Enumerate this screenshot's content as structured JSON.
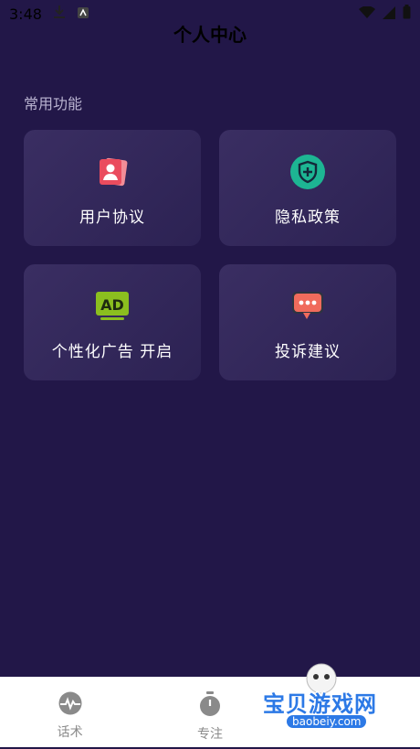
{
  "status_bar": {
    "time": "3:48"
  },
  "header": {
    "title": "个人中心"
  },
  "section": {
    "title": "常用功能"
  },
  "cards": [
    {
      "label": "用户协议",
      "icon": "user-agreement-icon",
      "color": "#ea4c5e"
    },
    {
      "label": "隐私政策",
      "icon": "shield-plus-icon",
      "color": "#1db593"
    },
    {
      "label": "个性化广告 开启",
      "icon": "ad-icon",
      "icon_text": "AD",
      "color": "#8bbf1f"
    },
    {
      "label": "投诉建议",
      "icon": "chat-bubble-icon",
      "color": "#f06b5c"
    }
  ],
  "tabs": [
    {
      "label": "话术",
      "icon": "waveform-icon"
    },
    {
      "label": "专注",
      "icon": "stopwatch-icon"
    }
  ],
  "watermark": {
    "text": "宝贝游戏网",
    "url": "baobeiy.com"
  }
}
